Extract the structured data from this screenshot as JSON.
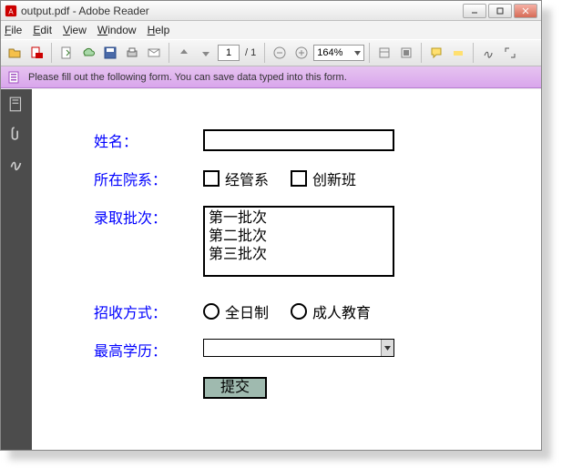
{
  "window": {
    "title": "output.pdf - Adobe Reader"
  },
  "menu": {
    "file": "File",
    "edit": "Edit",
    "view": "View",
    "window": "Window",
    "help": "Help"
  },
  "toolbar": {
    "page_current": "1",
    "page_total": "/ 1",
    "zoom": "164%"
  },
  "infobar": {
    "message": "Please fill out the following form. You can save data typed into this form."
  },
  "form": {
    "name_label": "姓名：",
    "dept_label": "所在院系：",
    "dept_opt1": "经管系",
    "dept_opt2": "创新班",
    "batch_label": "录取批次：",
    "batch_opt1": "第一批次",
    "batch_opt2": "第二批次",
    "batch_opt3": "第三批次",
    "mode_label": "招收方式：",
    "mode_opt1": "全日制",
    "mode_opt2": "成人教育",
    "edu_label": "最高学历：",
    "submit": "提交"
  }
}
